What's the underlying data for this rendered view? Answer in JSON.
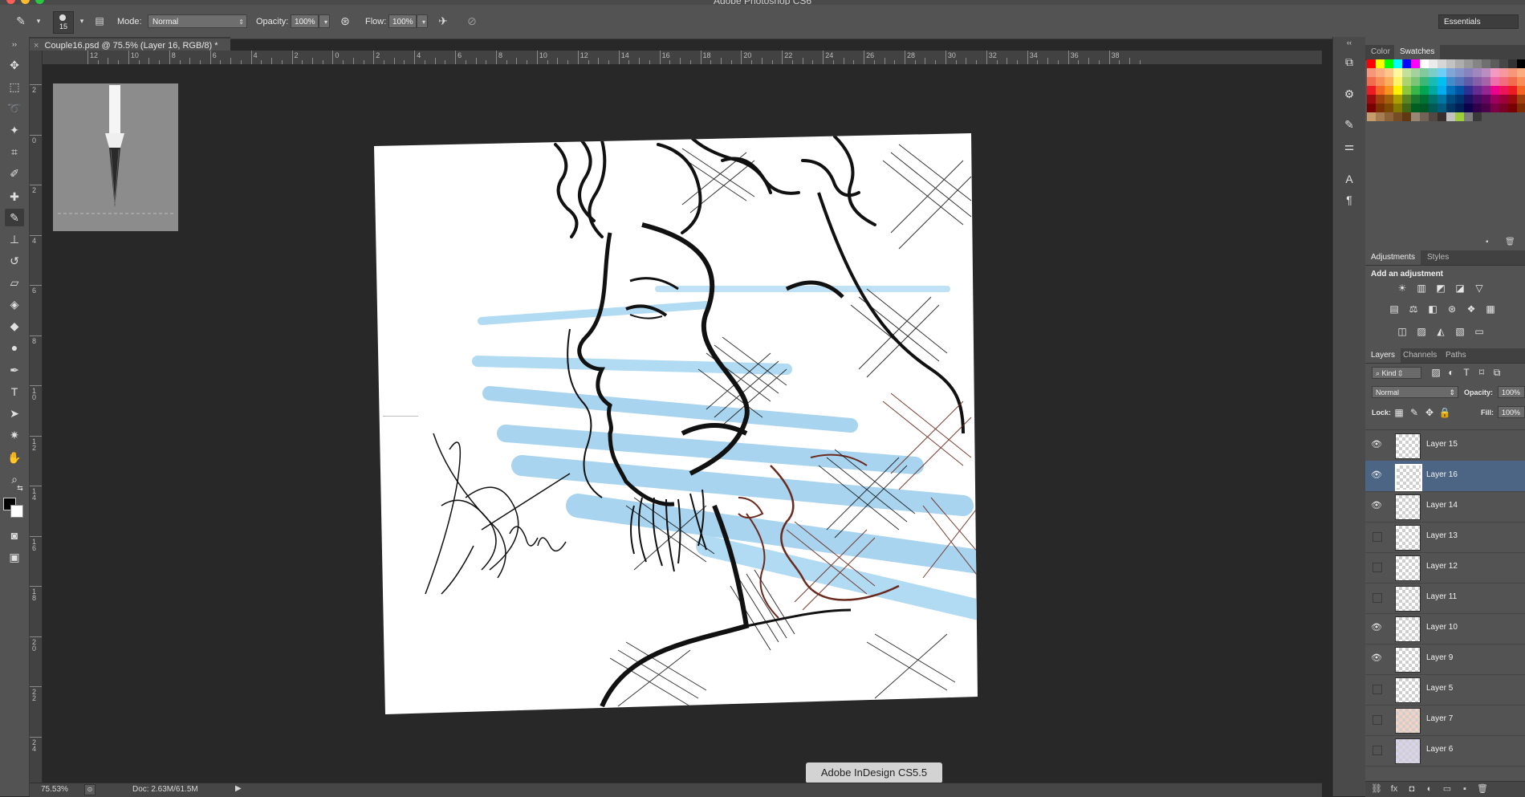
{
  "app": {
    "title": "Adobe Photoshop CS6",
    "workspace": "Essentials"
  },
  "options_bar": {
    "brush_size": "15",
    "mode_label": "Mode:",
    "mode_value": "Normal",
    "opacity_label": "Opacity:",
    "opacity_value": "100%",
    "flow_label": "Flow:",
    "flow_value": "100%"
  },
  "document": {
    "tab_title": "Couple16.psd @ 75.5% (Layer 16, RGB/8) *",
    "zoom": "75.53%",
    "doc_size": "Doc: 2.63M/61.5M"
  },
  "rulers": {
    "horizontal": [
      "12",
      "10",
      "8",
      "6",
      "4",
      "2",
      "0",
      "2",
      "4",
      "6",
      "8",
      "10",
      "12",
      "14",
      "16",
      "18",
      "20",
      "22",
      "24",
      "26",
      "28",
      "30",
      "32",
      "34",
      "36",
      "38"
    ],
    "vertical": [
      "2",
      "0",
      "2",
      "4",
      "6",
      "8",
      "1\n0",
      "1\n2",
      "1\n4",
      "1\n6",
      "1\n8",
      "2\n0",
      "2\n2",
      "2\n4"
    ]
  },
  "tooltip": "Adobe InDesign CS5.5",
  "panels": {
    "color_tabs": [
      {
        "label": "Color",
        "active": false
      },
      {
        "label": "Swatches",
        "active": true
      }
    ],
    "adjust_tabs": [
      {
        "label": "Adjustments",
        "active": true
      },
      {
        "label": "Styles",
        "active": false
      }
    ],
    "adjustments_title": "Add an adjustment",
    "layer_tabs": [
      {
        "label": "Layers",
        "active": true
      },
      {
        "label": "Channels",
        "active": false
      },
      {
        "label": "Paths",
        "active": false
      }
    ],
    "filter_kind": "Kind",
    "blend_mode": "Normal",
    "opacity_label": "Opacity:",
    "opacity_value": "100%",
    "lock_label": "Lock:",
    "fill_label": "Fill:",
    "fill_value": "100%",
    "layers": [
      {
        "name": "Layer 15",
        "visible": true,
        "selected": false
      },
      {
        "name": "Layer 16",
        "visible": true,
        "selected": true
      },
      {
        "name": "Layer 14",
        "visible": true,
        "selected": false
      },
      {
        "name": "Layer 13",
        "visible": false,
        "selected": false
      },
      {
        "name": "Layer 12",
        "visible": false,
        "selected": false
      },
      {
        "name": "Layer 11",
        "visible": false,
        "selected": false
      },
      {
        "name": "Layer 10",
        "visible": true,
        "selected": false
      },
      {
        "name": "Layer 9",
        "visible": true,
        "selected": false
      },
      {
        "name": "Layer 5",
        "visible": false,
        "selected": false
      },
      {
        "name": "Layer 7",
        "visible": false,
        "selected": false
      },
      {
        "name": "Layer 6",
        "visible": false,
        "selected": false
      }
    ]
  },
  "colors": {
    "ui_dark": "#282828",
    "ui_panel": "#535353",
    "selection": "#4c6585",
    "sky_blue": "#9fd0ee",
    "brown_ink": "#6b2a1e"
  }
}
